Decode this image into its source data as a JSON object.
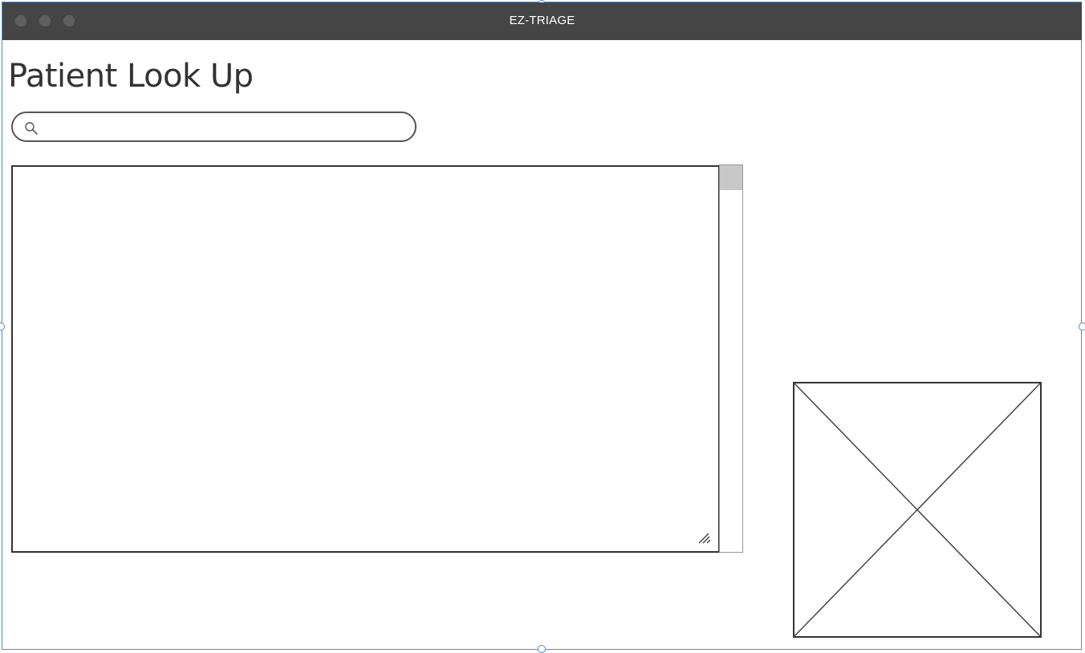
{
  "window": {
    "title": "EZ-TRIAGE",
    "controls": [
      "close-button",
      "minimize-button",
      "maximize-button"
    ]
  },
  "page": {
    "title": "Patient Look Up"
  },
  "search": {
    "icon": "search-icon",
    "value": "",
    "placeholder": ""
  },
  "results": {
    "content": ""
  },
  "image_placeholder": {
    "icon": "image-placeholder-icon"
  },
  "colors": {
    "titlebar": "#454545",
    "selection_outline": "#4a90d9",
    "border": "#333333",
    "scroll_thumb": "#c8c8c8"
  }
}
